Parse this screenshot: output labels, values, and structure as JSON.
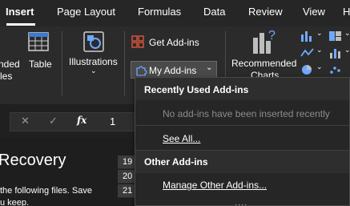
{
  "tabs": [
    "Insert",
    "Page Layout",
    "Formulas",
    "Data",
    "Review",
    "View",
    "H"
  ],
  "ribbon": {
    "addins_group_partial_label_1": "nded",
    "addins_group_partial_label_2": "les",
    "table_label": "Table",
    "illustrations_label": "Illustrations",
    "get_addins_label": "Get Add-ins",
    "my_addins_label": "My Add-ins",
    "recommended_charts_label_1": "Recommended",
    "recommended_charts_label_2": "Charts"
  },
  "formula_bar": {
    "cancel_symbol": "✕",
    "confirm_symbol": "✓",
    "fx_symbol": "fx",
    "value": "1"
  },
  "workspace": {
    "recovery_title": "Recovery",
    "recovery_text_1": "the following files.  Save",
    "recovery_text_2": "u keep.",
    "row_headers": [
      "19",
      "20",
      "21"
    ]
  },
  "dropdown": {
    "recently_used_header": "Recently Used Add-ins",
    "no_addins_text": "No add-ins have been inserted recently",
    "see_all_label": "See All...",
    "other_addins_header": "Other Add-ins",
    "manage_label": "Manage Other Add-ins...",
    "grip": "...."
  },
  "colors": {
    "tab_bar": "#262626",
    "ribbon": "#2b2b2b",
    "menu_bg": "#262626",
    "muted_text": "#8c8c8c",
    "accent_red": "#e0553a"
  }
}
